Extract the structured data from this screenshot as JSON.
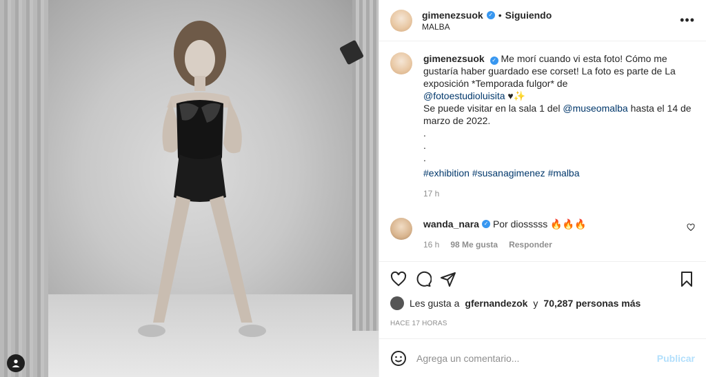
{
  "post": {
    "username": "gimenezsuok",
    "follow_label": "Siguiendo",
    "separator": "•",
    "location": "MALBA",
    "more_label": "•••",
    "caption": {
      "line1": "Me morí cuando vi esta foto! Cómo me gustaría haber guardado ese corset! La foto es parte de La exposición *Temporada fulgor* de",
      "mention1": "@fotoestudioluisita",
      "after_mention1": "♥✨",
      "line2_prefix": "Se puede visitar en la sala 1 del",
      "mention2": "@museomalba",
      "line2_suffix": "hasta el 14 de marzo de 2022.",
      "dot1": ".",
      "dot2": ".",
      "dot3": ".",
      "tag1": "#exhibition",
      "tag2": "#susanagimenez",
      "tag3": "#malba",
      "time": "17 h"
    },
    "comment": {
      "username": "wanda_nara",
      "text": "Por diosssss 🔥🔥🔥",
      "time": "16 h",
      "likes": "98 Me gusta",
      "reply": "Responder"
    },
    "likes": {
      "prefix": "Les gusta a",
      "user": "gfernandezok",
      "middle": "y",
      "count": "70,287 personas más"
    },
    "timestamp": "HACE 17 HORAS",
    "add_comment_placeholder": "Agrega un comentario...",
    "publish_label": "Publicar"
  },
  "colors": {
    "verified": "#3897f0",
    "link": "#00376b",
    "muted": "#8e8e8e",
    "publish": "#b2dffc"
  },
  "icons": {
    "like": "heart-icon",
    "comment": "comment-icon",
    "share": "share-icon",
    "save": "bookmark-icon",
    "emoji": "emoji-icon",
    "photo_user": "user-tag-icon"
  }
}
